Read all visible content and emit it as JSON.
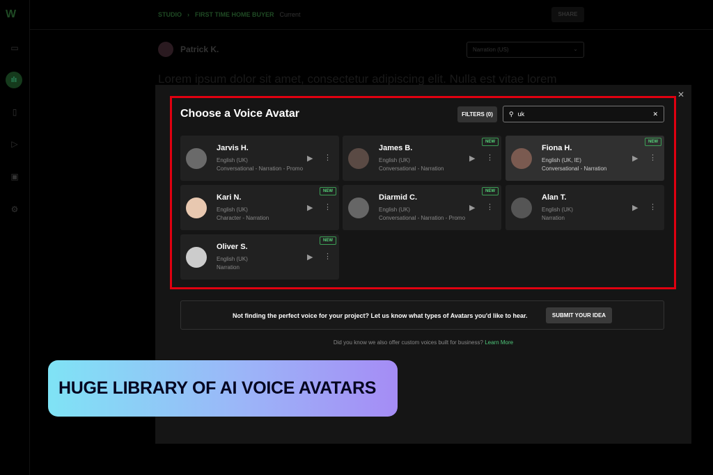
{
  "app": {
    "breadcrumb": [
      "STUDIO",
      "FIRST TIME HOME BUYER"
    ],
    "breadcrumb_status": "Current",
    "share_label": "SHARE"
  },
  "editor": {
    "author": "Patrick K.",
    "voice_style": "Narration (US)",
    "text": "Lorem ipsum dolor sit amet, consectetur adipiscing elit. Nulla est vitae lorem"
  },
  "modal": {
    "title": "Choose a Voice Avatar",
    "filters_label": "FILTERS (0)",
    "search_value": "uk",
    "avatars": [
      {
        "name": "Jarvis H.",
        "lang": "English (UK)",
        "tags": "Conversational - Narration - Promo",
        "new": false
      },
      {
        "name": "James B.",
        "lang": "English (UK)",
        "tags": "Conversational - Narration",
        "new": true
      },
      {
        "name": "Fiona H.",
        "lang": "English (UK, IE)",
        "tags": "Conversational - Narration",
        "new": true
      },
      {
        "name": "Kari N.",
        "lang": "English (UK)",
        "tags": "Character - Narration",
        "new": true
      },
      {
        "name": "Diarmid C.",
        "lang": "English (UK)",
        "tags": "Conversational - Narration - Promo",
        "new": true
      },
      {
        "name": "Alan T.",
        "lang": "English (UK)",
        "tags": "Narration",
        "new": false
      },
      {
        "name": "Oliver S.",
        "lang": "English (UK)",
        "tags": "Narration",
        "new": true
      }
    ],
    "new_label": "NEW",
    "banner_text": "Not finding the perfect voice for your project? Let us know what types of Avatars you'd like to hear.",
    "submit_label": "SUBMIT YOUR IDEA",
    "info_text": "Did you know we also offer custom voices built for business?",
    "learn_more": "Learn More"
  },
  "caption": "HUGE LIBRARY OF AI VOICE AVATARS"
}
